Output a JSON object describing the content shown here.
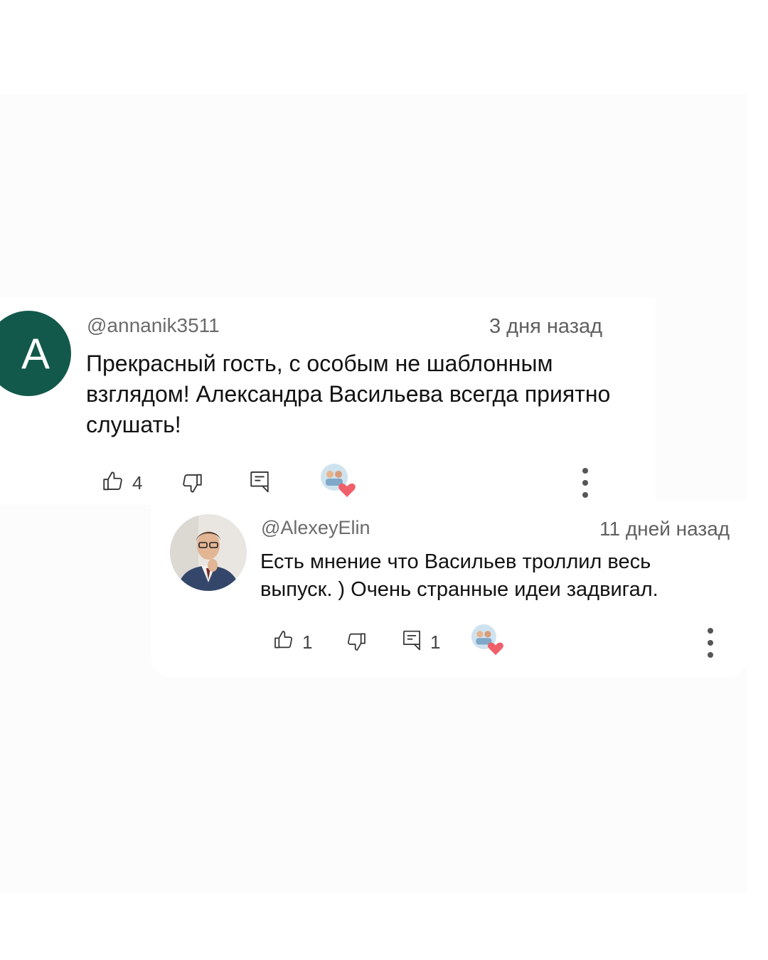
{
  "comment": {
    "avatar_letter": "A",
    "avatar_color": "#13594b",
    "username": "@annanik3511",
    "time": "3 дня назад",
    "text": "Прекрасный гость, с особым не шаблонным взглядом! Александра Васильева всегда приятно слушать!",
    "likes": "4",
    "icons": [
      "thumb-up-icon",
      "thumb-down-icon",
      "reply-icon",
      "creator-heart-icon",
      "more-options-icon"
    ]
  },
  "reply": {
    "username": "@AlexeyElin",
    "time": "11 дней назад",
    "text": "Есть мнение что Васильев троллил весь выпуск. ) Очень странные идеи задвигал.",
    "likes": "1",
    "replies": "1",
    "icons": [
      "thumb-up-icon",
      "thumb-down-icon",
      "reply-icon",
      "creator-heart-icon",
      "more-options-icon"
    ]
  }
}
